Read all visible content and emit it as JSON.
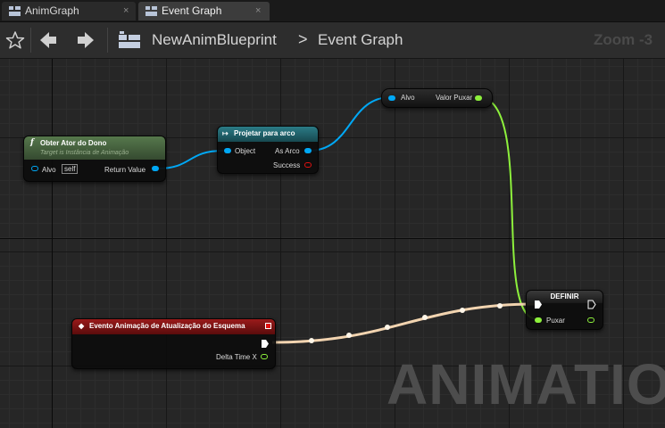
{
  "tabs": [
    {
      "label": "AnimGraph",
      "close": "×"
    },
    {
      "label": "Event Graph",
      "close": "×"
    }
  ],
  "toolbar": {
    "breadcrumb": [
      "NewAnimBlueprint",
      "Event Graph"
    ],
    "breadcrumb_separator": ">",
    "zoom": "Zoom -3",
    "icons": [
      "star-icon",
      "back-arrow-icon",
      "forward-arrow-icon",
      "blueprint-icon"
    ]
  },
  "watermark": "ANIMATION",
  "nodes": {
    "get_owner": {
      "icon": "f",
      "title": "Obter Ator do Dono",
      "subtitle": "Target is Instância de Animação",
      "in_pin": "Alvo",
      "self_label": "self",
      "out_pin": "Return Value"
    },
    "cast": {
      "icon": "↦",
      "title": "Projetar para arco",
      "in_pin": "Object",
      "out_pin": "As Arco",
      "success_pin": "Success"
    },
    "get_var": {
      "in_pin": "Alvo",
      "out_pin": "Valor Puxar"
    },
    "event": {
      "icon": "◆",
      "title": "Evento Animação de Atualização do Esquema",
      "out_pin": "Delta Time X"
    },
    "set": {
      "title": "DEFINIR",
      "in_pin": "Puxar"
    }
  },
  "colors": {
    "object_pin": "#00a8f5",
    "bool_pin": "#8df03c",
    "exec_wire": "#f2d4b0",
    "success_pin": "#e01010",
    "pure_header": "#45603c",
    "cast_header": "#1e5a63",
    "event_header": "#7a1010"
  }
}
